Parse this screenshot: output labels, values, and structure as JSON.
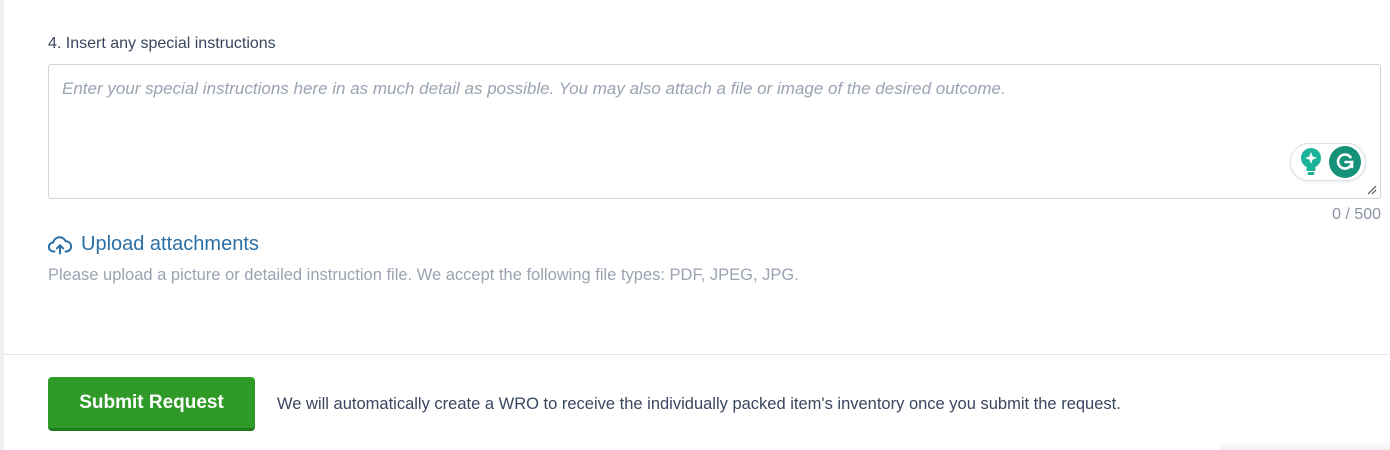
{
  "instructions": {
    "label": "4. Insert any special instructions",
    "placeholder": "Enter your special instructions here in as much detail as possible. You may also attach a file or image of the desired outcome.",
    "value": "",
    "char_count": "0 / 500"
  },
  "grammarly": {
    "suggestion_icon": "lightbulb-icon",
    "logo_icon": "grammarly-g-icon",
    "accent_color": "#15917a"
  },
  "upload": {
    "link_label": "Upload attachments",
    "icon": "cloud-upload-icon",
    "help_text": "Please upload a picture or detailed instruction file. We accept the following file types: PDF, JPEG, JPG."
  },
  "footer": {
    "submit_label": "Submit Request",
    "note": "We will automatically create a WRO to receive the individually packed item's inventory once you submit the request.",
    "submit_color": "#2f9a27"
  }
}
